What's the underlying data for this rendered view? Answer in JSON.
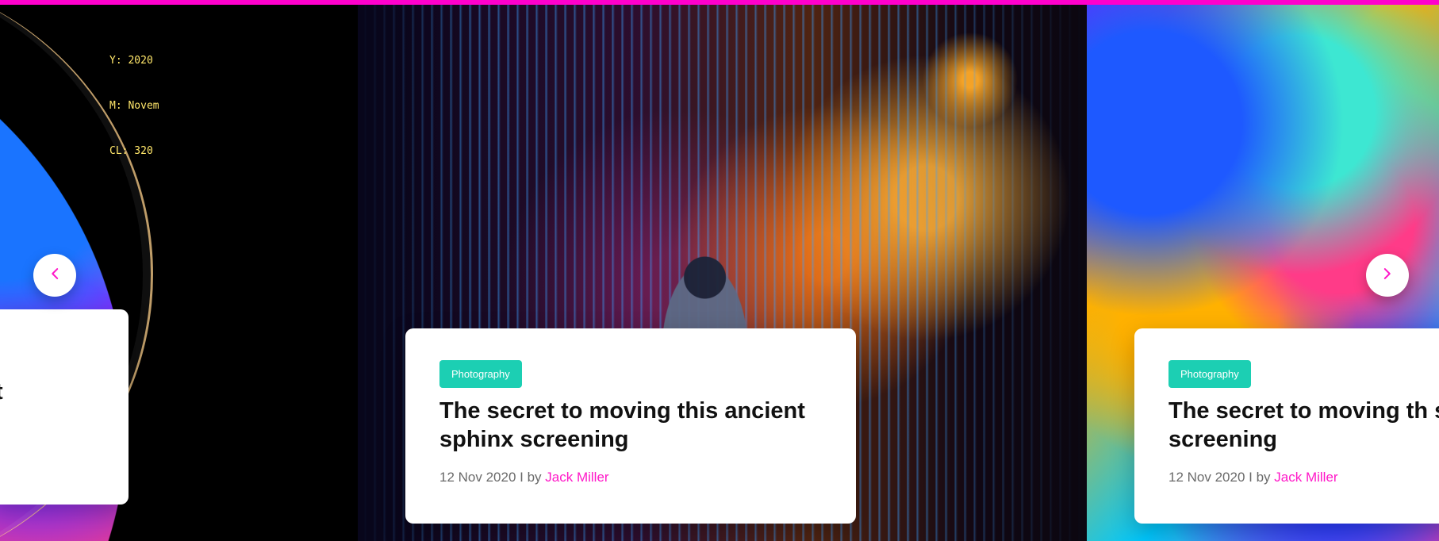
{
  "overlay": {
    "lines": [
      "Y: 2020",
      "M: Novem",
      "CL: 320"
    ]
  },
  "carousel": {
    "prev_icon": "chevron-left-icon",
    "next_icon": "chevron-right-icon"
  },
  "cards": [
    {
      "category": "",
      "title": "s ancient",
      "date": "",
      "by": "",
      "author": ""
    },
    {
      "category": "Photography",
      "title": "The secret to moving this ancient sphinx screening",
      "date": "12 Nov 2020",
      "by": "I by",
      "author": "Jack Miller"
    },
    {
      "category": "Photography",
      "title": "The secret to moving th sphinx screening",
      "date": "12 Nov 2020",
      "by": "I by",
      "author": "Jack Miller"
    }
  ],
  "colors": {
    "accent_top": "#ff00cc",
    "tag_bg": "#1ccfb3",
    "author_link": "#ff18c8",
    "chevron": "#ff18c8"
  }
}
